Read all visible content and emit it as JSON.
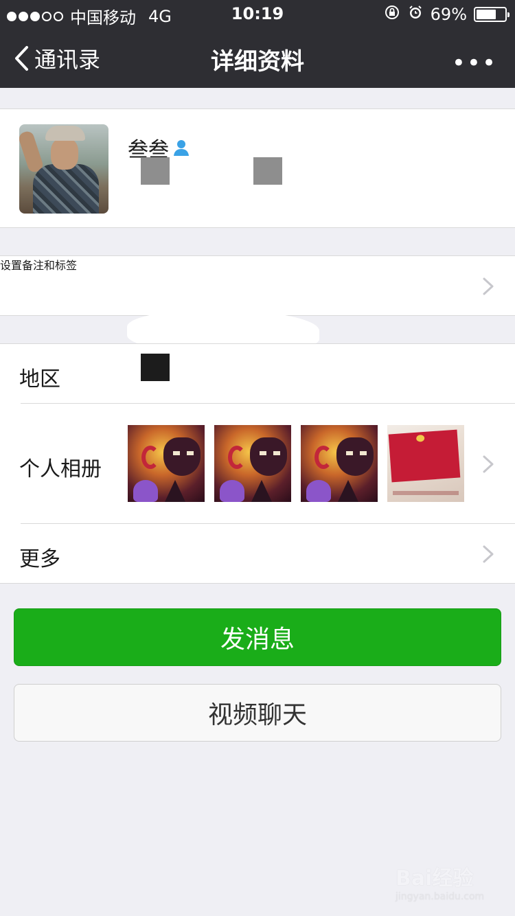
{
  "status_bar": {
    "signal_filled": 3,
    "signal_total": 5,
    "carrier": "中国移动",
    "network": "4G",
    "time": "10:19",
    "battery_percent_text": "69%",
    "battery_level": 0.69,
    "icons": [
      "rotation-lock-icon",
      "alarm-icon",
      "battery-icon"
    ]
  },
  "nav": {
    "back_label": "通讯录",
    "title": "详细资料",
    "more_label": "•••"
  },
  "profile": {
    "nickname": "叁叁",
    "badge_icon": "person-icon",
    "avatar": "avatar-photo"
  },
  "rows": {
    "remark_label": "设置备注和标签",
    "region_label": "地区",
    "album_label": "个人相册",
    "more_label": "更多"
  },
  "album": {
    "thumbnails": [
      "game-art",
      "game-art",
      "game-art",
      "red-invitation-card"
    ]
  },
  "buttons": {
    "send_message": "发消息",
    "video_call": "视频聊天"
  },
  "colors": {
    "nav_bg": "#2e2e33",
    "primary_green": "#1aad19",
    "page_bg": "#efeff4",
    "badge_blue": "#3aa2e6"
  },
  "watermark": {
    "main": "Bai经验",
    "sub": "jingyan.baidu.com"
  }
}
